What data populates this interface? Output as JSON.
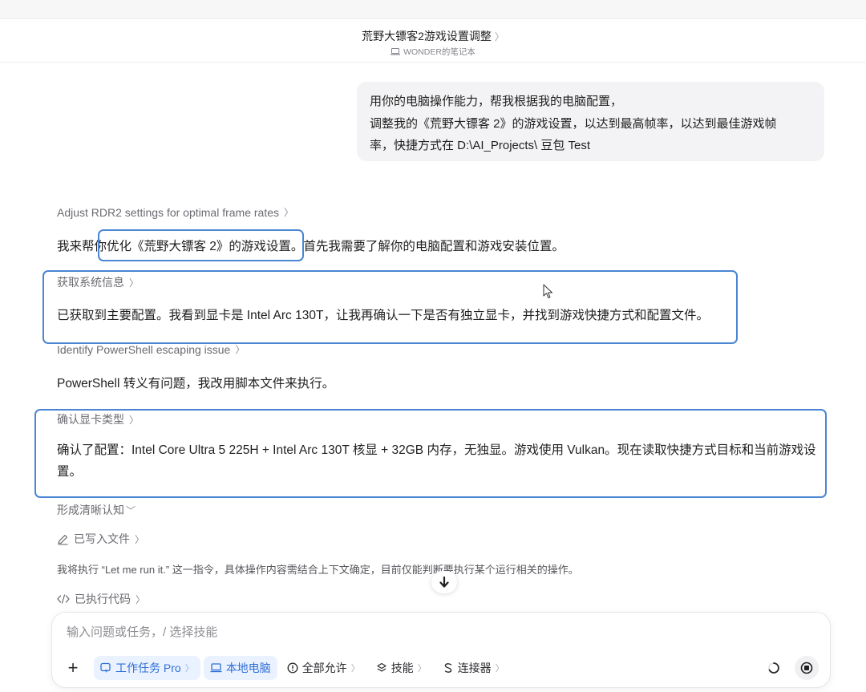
{
  "header": {
    "title": "荒野大镖客2游戏设置调整",
    "title_chevron": "〉",
    "subtitle": "WONDER的笔记本"
  },
  "user_message": {
    "lines": [
      "用你的电脑操作能力，帮我根据我的电脑配置，",
      "调整我的《荒野大镖客 2》的游戏设置，以达到最高帧率，以达到最佳游戏帧",
      "率，快捷方式在 D:\\AI_Projects\\ 豆包 Test"
    ]
  },
  "conversation": {
    "step1": {
      "label": "Adjust RDR2 settings for optimal frame rates",
      "arrow": "〉"
    },
    "para1": "我来帮你优化《荒野大镖客 2》的游戏设置。首先我需要了解你的电脑配置和游戏安装位置。",
    "step2": {
      "label": "获取系统信息",
      "arrow": "〉"
    },
    "para2": "已获取到主要配置。我看到显卡是 Intel Arc 130T，让我再确认一下是否有独立显卡，并找到游戏快捷方式和配置文件。",
    "step3": {
      "label": "Identify PowerShell escaping issue",
      "arrow": "〉"
    },
    "para3": "PowerShell 转义有问题，我改用脚本文件来执行。",
    "step4": {
      "label": "确认显卡类型",
      "arrow": "〉"
    },
    "para4": "确认了配置：Intel Core Ultra 5 225H + Intel Arc 130T 核显 + 32GB 内存，无独显。游戏使用 Vulkan。现在读取快捷方式目标和当前游戏设置。",
    "step5": {
      "label": "形成清晰认知",
      "arrow": "﹀"
    },
    "step6": {
      "label": "已写入文件",
      "arrow": "〉"
    },
    "para6": "我将执行 “Let me run it.” 这一指令，具体操作内容需结合上下文确定，目前仅能判断要执行某个运行相关的操作。",
    "step7": {
      "label": "已执行代码",
      "arrow": "〉"
    }
  },
  "composer": {
    "placeholder": "输入问题或任务，/ 选择技能",
    "plus": "+",
    "chips": {
      "task": "工作任务 Pro",
      "computer": "本地电脑",
      "allow": "全部允许",
      "skills": "技能",
      "connectors": "连接器"
    },
    "chevron": "〉"
  },
  "colors": {
    "accent": "#2f6fd6",
    "highlight_border": "#4a86d4",
    "chip_bg": "#eaf2ff",
    "user_bubble": "#f3f3f5"
  }
}
